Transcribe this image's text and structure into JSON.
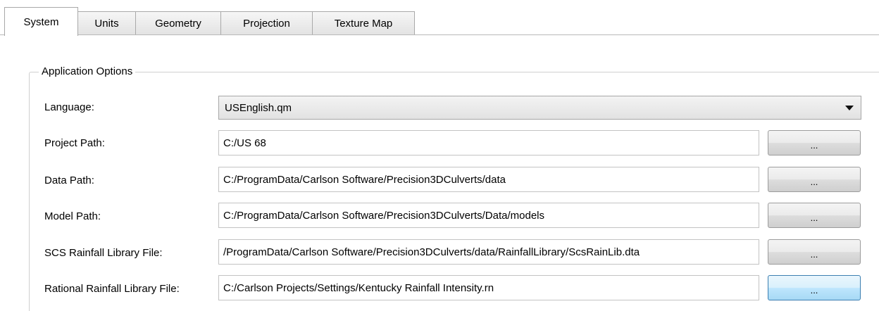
{
  "tabs": [
    {
      "label": "System",
      "active": true
    },
    {
      "label": "Units",
      "active": false
    },
    {
      "label": "Geometry",
      "active": false
    },
    {
      "label": "Projection",
      "active": false
    },
    {
      "label": "Texture Map",
      "active": false
    }
  ],
  "group": {
    "title": "Application Options"
  },
  "language": {
    "label": "Language:",
    "selected": "USEnglish.qm"
  },
  "fields": [
    {
      "label": "Project Path:",
      "value": "C:/US 68",
      "button": "..."
    },
    {
      "label": "Data Path:",
      "value": "C:/ProgramData/Carlson Software/Precision3DCulverts/data",
      "button": "..."
    },
    {
      "label": "Model Path:",
      "value": "C:/ProgramData/Carlson Software/Precision3DCulverts/Data/models",
      "button": "..."
    },
    {
      "label": "SCS Rainfall Library File:",
      "value": "/ProgramData/Carlson Software/Precision3DCulverts/data/RainfallLibrary/ScsRainLib.dta",
      "button": "..."
    },
    {
      "label": "Rational Rainfall Library File:",
      "value": "C:/Carlson Projects/Settings/Kentucky Rainfall Intensity.rn",
      "button": "..."
    }
  ]
}
